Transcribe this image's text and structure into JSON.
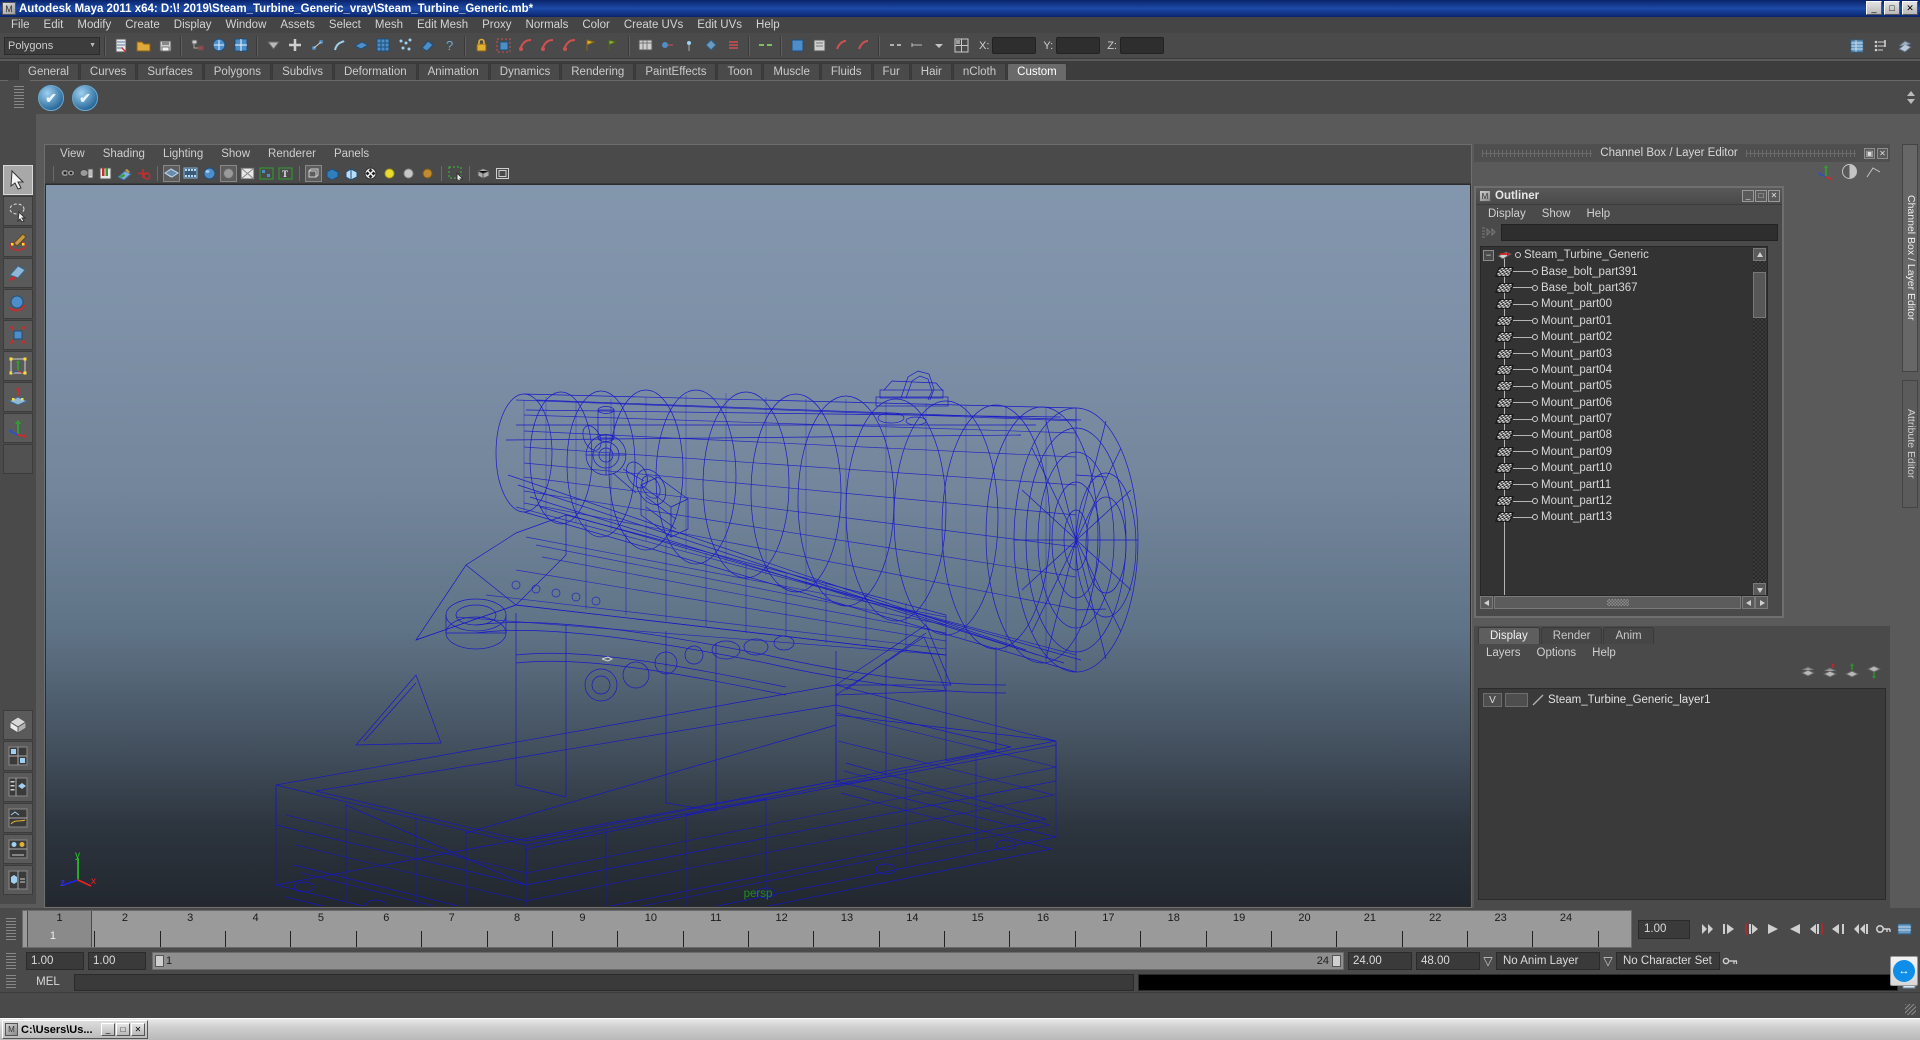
{
  "window": {
    "title": "Autodesk Maya 2011 x64: D:\\! 2019\\Steam_Turbine_Generic_vray\\Steam_Turbine_Generic.mb*",
    "app_icon": "maya-icon",
    "minimize": "_",
    "maximize": "□",
    "close": "✕"
  },
  "menubar": {
    "items": [
      "File",
      "Edit",
      "Modify",
      "Create",
      "Display",
      "Window",
      "Assets",
      "Select",
      "Mesh",
      "Edit Mesh",
      "Proxy",
      "Normals",
      "Color",
      "Create UVs",
      "Edit UVs",
      "Help"
    ]
  },
  "statusline": {
    "menu_set": "Polygons",
    "menu_set_arrow": "▼",
    "coord_labels": {
      "x": "X:",
      "y": "Y:",
      "z": "Z:"
    },
    "coord_values": {
      "x": "",
      "y": "",
      "z": ""
    },
    "icons": [
      "new-scene-icon",
      "open-scene-icon",
      "save-scene-icon",
      "select-by-hierarchy-icon",
      "select-by-object-icon",
      "select-by-component-icon",
      "select-mask-icon",
      "snap-to-grid-icon",
      "snap-to-curve-icon",
      "snap-to-point-icon",
      "snap-to-view-plane-icon",
      "snap-to-pixel-icon",
      "make-live-icon",
      "help-icon",
      "lock-icon",
      "render-current-frame-icon",
      "ipr-render-icon",
      "render-settings-icon",
      "hypergraph-icon",
      "hypershade-icon",
      "render-view-icon",
      "attribute-editor-icon",
      "tool-settings-icon",
      "channel-box-icon"
    ]
  },
  "shelf": {
    "tabs": [
      "General",
      "Curves",
      "Surfaces",
      "Polygons",
      "Subdivs",
      "Deformation",
      "Animation",
      "Dynamics",
      "Rendering",
      "PaintEffects",
      "Toon",
      "Muscle",
      "Fluids",
      "Fur",
      "Hair",
      "nCloth",
      "Custom"
    ],
    "active_tab": "Custom",
    "buttons": [
      "custom-shelf-item-1",
      "custom-shelf-item-2"
    ],
    "button_glyph": "✔"
  },
  "toolbox": {
    "items": [
      {
        "name": "select-tool",
        "selected": true
      },
      {
        "name": "lasso-select-tool",
        "selected": false
      },
      {
        "name": "paint-select-tool",
        "selected": false
      },
      {
        "name": "move-tool",
        "selected": false
      },
      {
        "name": "rotate-tool",
        "selected": false
      },
      {
        "name": "scale-tool",
        "selected": false
      },
      {
        "name": "universal-manipulator-tool",
        "selected": false
      },
      {
        "name": "soft-modification-tool",
        "selected": false
      },
      {
        "name": "show-manipulator-tool",
        "selected": false
      },
      {
        "name": "last-tool-used",
        "selected": false
      }
    ],
    "quick_layout": [
      "single-perspective-view-icon",
      "four-view-layout-icon",
      "outliner-persp-layout-icon",
      "persp-graph-layout-icon",
      "hypershade-persp-layout-icon",
      "persp-poly-layout-icon"
    ]
  },
  "viewport": {
    "menus": [
      "View",
      "Shading",
      "Lighting",
      "Show",
      "Renderer",
      "Panels"
    ],
    "toolbar_icons": [
      "select-camera-icon",
      "camera-attributes-icon",
      "bookmark-icon",
      "image-plane-icon",
      "2d-pan-zoom-icon",
      "wireframe-icon",
      "smooth-shade-all-icon",
      "smooth-shade-selected-icon",
      "flat-shade-icon",
      "shaded-wireframe-icon",
      "texture-icon",
      "use-all-lights-icon",
      "shadows-icon",
      "xray-icon",
      "xray-joints-icon",
      "isolate-select-icon",
      "high-quality-render-icon",
      "grid-toggle-icon",
      "film-gate-icon",
      "resolution-gate-icon",
      "exposure-icon",
      "gamma-icon"
    ],
    "camera_label": "persp",
    "axis_labels": {
      "x": "x",
      "y": "y",
      "z": "z"
    },
    "model_color": "#1616c8",
    "model_name": "Steam_Turbine_Generic"
  },
  "channel_box_header": {
    "title": "Channel Box / Layer Editor",
    "buttons": [
      "restore-panel-button",
      "close-panel-button"
    ],
    "icons": [
      "move-axis-icon",
      "contrast-icon",
      "graph-icon"
    ]
  },
  "outliner": {
    "title": "Outliner",
    "window_buttons": {
      "minimize": "_",
      "maximize": "□",
      "close": "✕"
    },
    "menus": [
      "Display",
      "Show",
      "Help"
    ],
    "search_value": "",
    "search_icon": "filter-icon",
    "root": {
      "label": "Steam_Turbine_Generic",
      "icon": "transform-arrow-icon",
      "expander": "−"
    },
    "items": [
      "Base_bolt_part391",
      "Base_bolt_part367",
      "Mount_part00",
      "Mount_part01",
      "Mount_part02",
      "Mount_part03",
      "Mount_part04",
      "Mount_part05",
      "Mount_part06",
      "Mount_part07",
      "Mount_part08",
      "Mount_part09",
      "Mount_part10",
      "Mount_part11",
      "Mount_part12",
      "Mount_part13"
    ],
    "item_icon": "polygon-mesh-icon",
    "scroll_up": "▲",
    "scroll_down": "▼",
    "hscroll_left": "◀",
    "hscroll_right": "▶"
  },
  "layer_editor": {
    "tabs": [
      "Display",
      "Render",
      "Anim"
    ],
    "active_tab": "Display",
    "menus": [
      "Layers",
      "Options",
      "Help"
    ],
    "toolbar_icons": [
      "new-layer-icon",
      "new-layer-from-selected-icon",
      "layer-up-icon",
      "layer-down-icon"
    ],
    "layers": [
      {
        "visibility": "V",
        "display_type": "",
        "name": "Steam_Turbine_Generic_layer1"
      }
    ]
  },
  "right_tabs": [
    {
      "label": "Channel Box / Layer Editor",
      "active": true
    },
    {
      "label": "Attribute Editor",
      "active": false
    }
  ],
  "timeslider": {
    "tick_labels": [
      "1",
      "2",
      "3",
      "4",
      "5",
      "6",
      "7",
      "8",
      "9",
      "10",
      "11",
      "12",
      "13",
      "14",
      "15",
      "16",
      "17",
      "18",
      "19",
      "20",
      "21",
      "22",
      "23",
      "24"
    ],
    "current_frame": "1",
    "current_frame_field": "1.00",
    "playback_buttons": [
      "go-to-start-icon",
      "step-back-keyframe-icon",
      "step-back-frame-icon",
      "play-backwards-icon",
      "play-forwards-icon",
      "step-forward-frame-icon",
      "step-forward-keyframe-icon",
      "go-to-end-icon"
    ],
    "auto_key_icon": "auto-keyframe-icon",
    "anim_prefs_icon": "animation-preferences-icon"
  },
  "rangeslider": {
    "anim_start": "1.00",
    "range_start": "1.00",
    "bar_start_label": "1",
    "bar_end_label": "24",
    "range_end": "24.00",
    "anim_end": "48.00",
    "anim_layer": "No Anim Layer",
    "character_set": "No Character Set",
    "anim_layer_arrow": "▽",
    "character_set_arrow": "▽",
    "key_icon": "key-icon"
  },
  "command_line": {
    "language_label": "MEL",
    "input_value": "",
    "output_value": "",
    "script_editor_icon": "script-editor-icon"
  },
  "taskbar": {
    "items": [
      {
        "label": "C:\\Users\\Us...",
        "icon": "maya-icon",
        "buttons": [
          "_",
          "□",
          "✕"
        ]
      }
    ]
  },
  "float_widget": {
    "name": "remote-control-widget",
    "glyph": "↔",
    "color": "#0e8ee9"
  }
}
